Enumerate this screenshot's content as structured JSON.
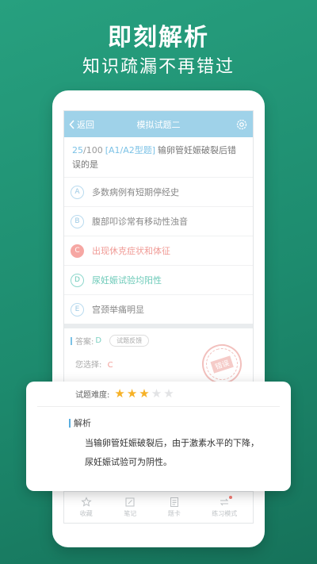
{
  "hero": {
    "title": "即刻解析",
    "subtitle": "知识疏漏不再错过"
  },
  "navbar": {
    "back_label": "返回",
    "title": "模拟试题二",
    "color": "#9fd2e9"
  },
  "question": {
    "number": "25",
    "total": "/100",
    "type": "[A1/A2型题]",
    "text": "输卵管妊娠破裂后错误的是"
  },
  "options": [
    {
      "letter": "A",
      "text": "多数病例有短期停经史",
      "state": "normal"
    },
    {
      "letter": "B",
      "text": "腹部叩诊常有移动性浊音",
      "state": "normal"
    },
    {
      "letter": "C",
      "text": "出现休克症状和体征",
      "state": "wrong"
    },
    {
      "letter": "D",
      "text": "尿妊娠试验均阳性",
      "state": "correct"
    },
    {
      "letter": "E",
      "text": "宫颈举痛明显",
      "state": "normal"
    }
  ],
  "answer": {
    "label": "答案:",
    "key": "D",
    "feedback_label": "试题反馈",
    "your_choice_label": "您选择:",
    "your_choice": "C",
    "stamp_text": "错误"
  },
  "tabbar": [
    {
      "label": "收藏",
      "icon": "star-outline-icon"
    },
    {
      "label": "笔记",
      "icon": "note-edit-icon"
    },
    {
      "label": "题卡",
      "icon": "answer-card-icon"
    },
    {
      "label": "练习模式",
      "icon": "switch-mode-icon"
    }
  ],
  "card": {
    "difficulty_label": "试题难度:",
    "difficulty_stars": 3,
    "difficulty_max": 5,
    "analysis_label": "解析",
    "analysis_text_1": "当输卵管妊娠破裂后，由于激素水平的下降，",
    "analysis_text_2": "尿妊娠试验可为阴性。"
  },
  "colors": {
    "background": "#1f9070",
    "accent_blue": "#7cc2e6",
    "wrong": "#f09a95",
    "correct": "#6ccab8",
    "star": "#f6b126"
  }
}
